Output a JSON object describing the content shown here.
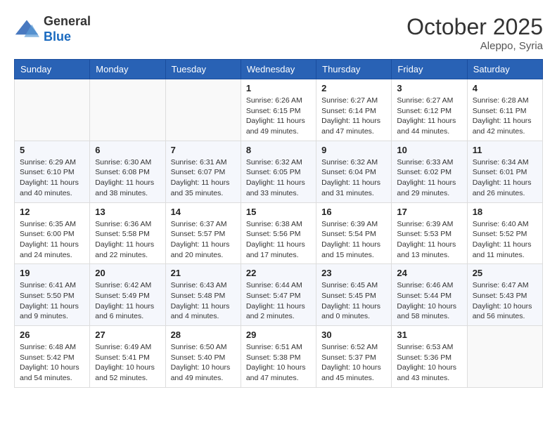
{
  "header": {
    "logo_line1": "General",
    "logo_line2": "Blue",
    "month": "October 2025",
    "location": "Aleppo, Syria"
  },
  "weekdays": [
    "Sunday",
    "Monday",
    "Tuesday",
    "Wednesday",
    "Thursday",
    "Friday",
    "Saturday"
  ],
  "weeks": [
    [
      {
        "day": "",
        "info": ""
      },
      {
        "day": "",
        "info": ""
      },
      {
        "day": "",
        "info": ""
      },
      {
        "day": "1",
        "info": "Sunrise: 6:26 AM\nSunset: 6:15 PM\nDaylight: 11 hours\nand 49 minutes."
      },
      {
        "day": "2",
        "info": "Sunrise: 6:27 AM\nSunset: 6:14 PM\nDaylight: 11 hours\nand 47 minutes."
      },
      {
        "day": "3",
        "info": "Sunrise: 6:27 AM\nSunset: 6:12 PM\nDaylight: 11 hours\nand 44 minutes."
      },
      {
        "day": "4",
        "info": "Sunrise: 6:28 AM\nSunset: 6:11 PM\nDaylight: 11 hours\nand 42 minutes."
      }
    ],
    [
      {
        "day": "5",
        "info": "Sunrise: 6:29 AM\nSunset: 6:10 PM\nDaylight: 11 hours\nand 40 minutes."
      },
      {
        "day": "6",
        "info": "Sunrise: 6:30 AM\nSunset: 6:08 PM\nDaylight: 11 hours\nand 38 minutes."
      },
      {
        "day": "7",
        "info": "Sunrise: 6:31 AM\nSunset: 6:07 PM\nDaylight: 11 hours\nand 35 minutes."
      },
      {
        "day": "8",
        "info": "Sunrise: 6:32 AM\nSunset: 6:05 PM\nDaylight: 11 hours\nand 33 minutes."
      },
      {
        "day": "9",
        "info": "Sunrise: 6:32 AM\nSunset: 6:04 PM\nDaylight: 11 hours\nand 31 minutes."
      },
      {
        "day": "10",
        "info": "Sunrise: 6:33 AM\nSunset: 6:02 PM\nDaylight: 11 hours\nand 29 minutes."
      },
      {
        "day": "11",
        "info": "Sunrise: 6:34 AM\nSunset: 6:01 PM\nDaylight: 11 hours\nand 26 minutes."
      }
    ],
    [
      {
        "day": "12",
        "info": "Sunrise: 6:35 AM\nSunset: 6:00 PM\nDaylight: 11 hours\nand 24 minutes."
      },
      {
        "day": "13",
        "info": "Sunrise: 6:36 AM\nSunset: 5:58 PM\nDaylight: 11 hours\nand 22 minutes."
      },
      {
        "day": "14",
        "info": "Sunrise: 6:37 AM\nSunset: 5:57 PM\nDaylight: 11 hours\nand 20 minutes."
      },
      {
        "day": "15",
        "info": "Sunrise: 6:38 AM\nSunset: 5:56 PM\nDaylight: 11 hours\nand 17 minutes."
      },
      {
        "day": "16",
        "info": "Sunrise: 6:39 AM\nSunset: 5:54 PM\nDaylight: 11 hours\nand 15 minutes."
      },
      {
        "day": "17",
        "info": "Sunrise: 6:39 AM\nSunset: 5:53 PM\nDaylight: 11 hours\nand 13 minutes."
      },
      {
        "day": "18",
        "info": "Sunrise: 6:40 AM\nSunset: 5:52 PM\nDaylight: 11 hours\nand 11 minutes."
      }
    ],
    [
      {
        "day": "19",
        "info": "Sunrise: 6:41 AM\nSunset: 5:50 PM\nDaylight: 11 hours\nand 9 minutes."
      },
      {
        "day": "20",
        "info": "Sunrise: 6:42 AM\nSunset: 5:49 PM\nDaylight: 11 hours\nand 6 minutes."
      },
      {
        "day": "21",
        "info": "Sunrise: 6:43 AM\nSunset: 5:48 PM\nDaylight: 11 hours\nand 4 minutes."
      },
      {
        "day": "22",
        "info": "Sunrise: 6:44 AM\nSunset: 5:47 PM\nDaylight: 11 hours\nand 2 minutes."
      },
      {
        "day": "23",
        "info": "Sunrise: 6:45 AM\nSunset: 5:45 PM\nDaylight: 11 hours\nand 0 minutes."
      },
      {
        "day": "24",
        "info": "Sunrise: 6:46 AM\nSunset: 5:44 PM\nDaylight: 10 hours\nand 58 minutes."
      },
      {
        "day": "25",
        "info": "Sunrise: 6:47 AM\nSunset: 5:43 PM\nDaylight: 10 hours\nand 56 minutes."
      }
    ],
    [
      {
        "day": "26",
        "info": "Sunrise: 6:48 AM\nSunset: 5:42 PM\nDaylight: 10 hours\nand 54 minutes."
      },
      {
        "day": "27",
        "info": "Sunrise: 6:49 AM\nSunset: 5:41 PM\nDaylight: 10 hours\nand 52 minutes."
      },
      {
        "day": "28",
        "info": "Sunrise: 6:50 AM\nSunset: 5:40 PM\nDaylight: 10 hours\nand 49 minutes."
      },
      {
        "day": "29",
        "info": "Sunrise: 6:51 AM\nSunset: 5:38 PM\nDaylight: 10 hours\nand 47 minutes."
      },
      {
        "day": "30",
        "info": "Sunrise: 6:52 AM\nSunset: 5:37 PM\nDaylight: 10 hours\nand 45 minutes."
      },
      {
        "day": "31",
        "info": "Sunrise: 6:53 AM\nSunset: 5:36 PM\nDaylight: 10 hours\nand 43 minutes."
      },
      {
        "day": "",
        "info": ""
      }
    ]
  ]
}
